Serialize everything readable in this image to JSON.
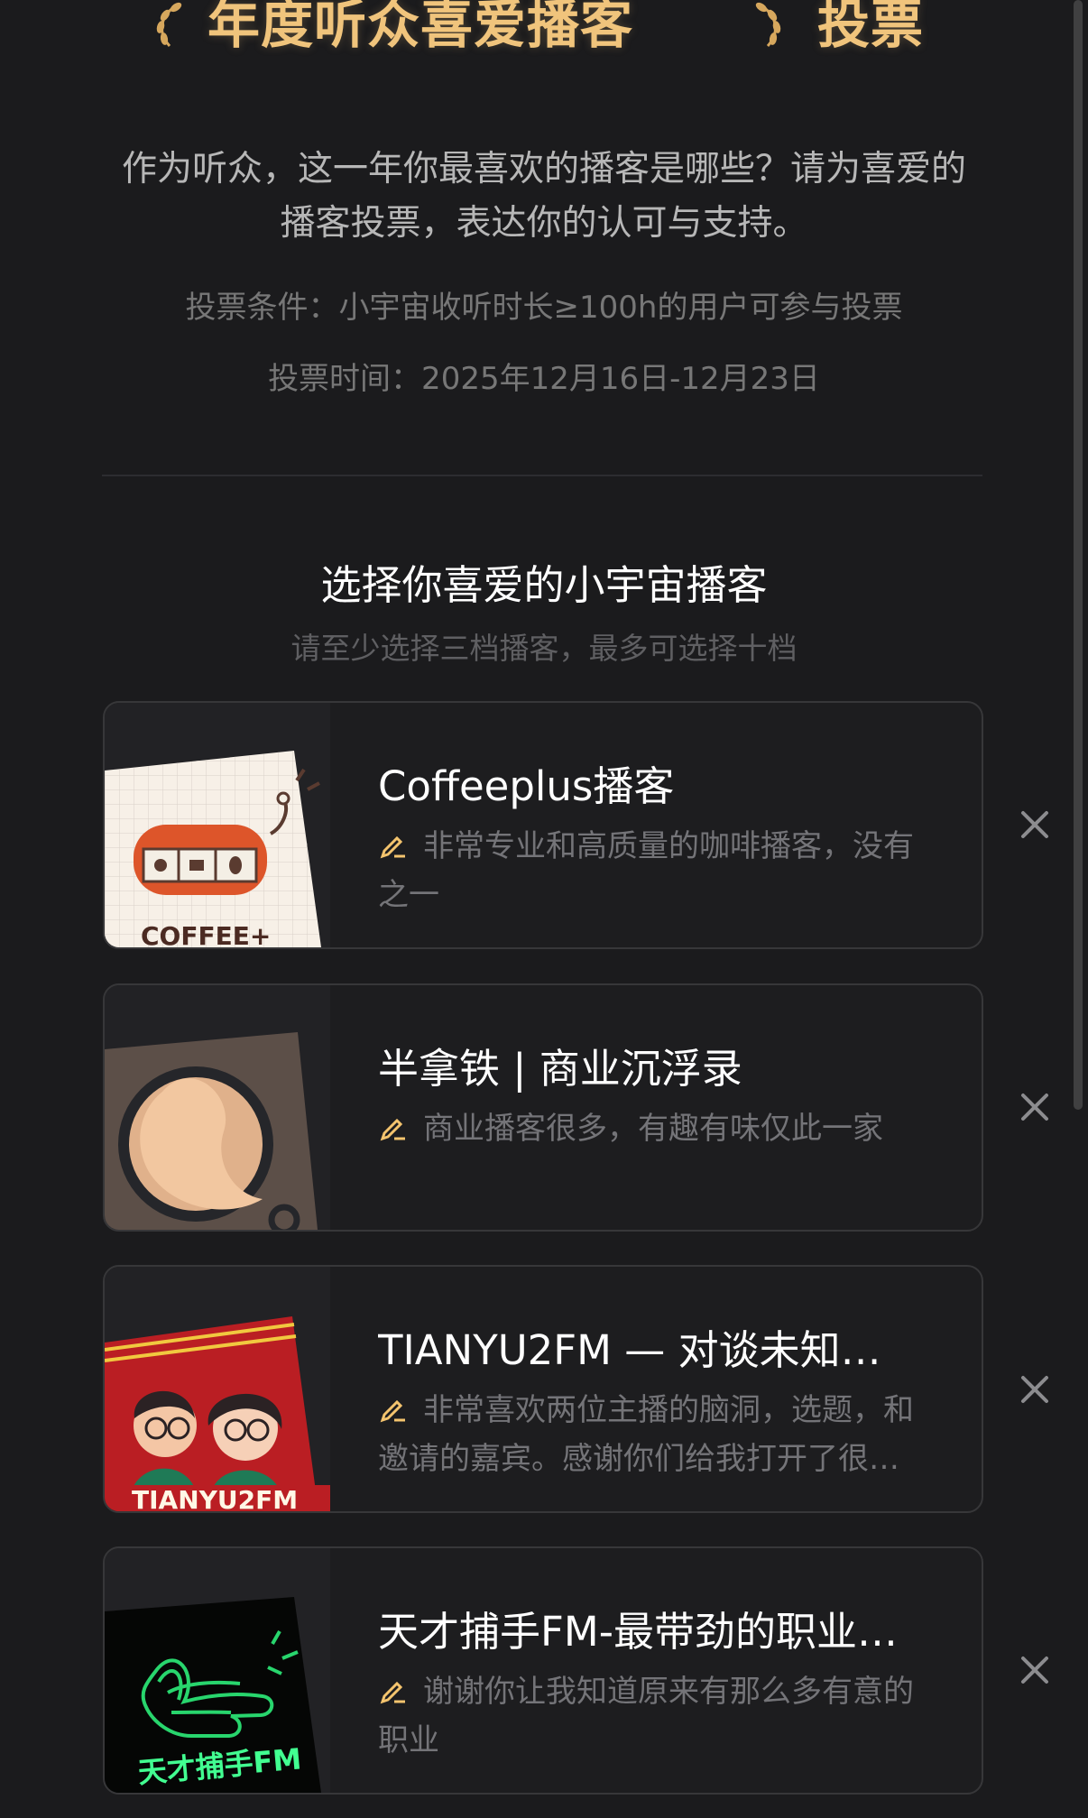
{
  "hero": {
    "title": "年度听众喜爱播客",
    "title_suffix": "投票",
    "laurel_icon": "laurel-icon",
    "accent": "#f0c47c"
  },
  "intro": {
    "line1": "作为听众，这一年你最喜欢的播客是哪些？请为喜爱的",
    "line2": "播客投票，表达你的认可与支持。"
  },
  "rules": {
    "condition": "投票条件：小宇宙收听时长≥100h的用户可参与投票",
    "time": "投票时间：2025年12月16日-12月23日"
  },
  "section": {
    "title": "选择你喜爱的小宇宙播客",
    "subtitle": "请至少选择三档播客，最多可选择十档"
  },
  "podcasts": [
    {
      "name": "Coffeeplus播客",
      "note": "非常专业和高质量的咖啡播客，没有之一",
      "cover_text": "COFFEE+"
    },
    {
      "name": "半拿铁 | 商业沉浮录",
      "note": "商业播客很多，有趣有味仅此一家"
    },
    {
      "name": "TIANYU2FM — 对谈未知…",
      "note": "非常喜欢两位主播的脑洞，选题，和邀请的嘉宾。感谢你们给我打开了很…",
      "cover_text": "TIANYU2FM"
    },
    {
      "name": "天才捕手FM-最带劲的职业…",
      "note": "谢谢你让我知道原来有那么多有意的职业",
      "cover_text": "天才捕手FM"
    }
  ],
  "icons": {
    "edit": "pen-icon",
    "remove": "close-icon"
  },
  "colors": {
    "background": "#1b1b1d",
    "card": "#1d1d1f",
    "border": "#373739",
    "muted": "#747478",
    "pen": "#f4c46e"
  }
}
